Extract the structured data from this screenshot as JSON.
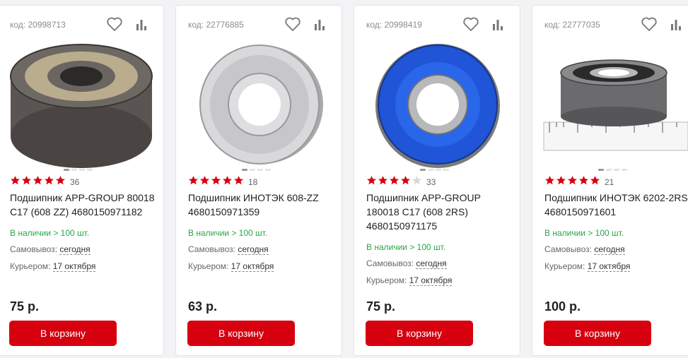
{
  "colors": {
    "accent": "#d6000f",
    "stock": "#28a745",
    "star": "#d6000f"
  },
  "products": [
    {
      "code": "код: 20998713",
      "rating_stars": 5,
      "reviews": "36",
      "title": "Подшипник APP-GROUP 80018 C17 (608 ZZ) 4680150971182",
      "stock": "В наличии > 100 шт.",
      "pickup_label": "Самовывоз:",
      "pickup_value": "сегодня",
      "courier_label": "Курьером:",
      "courier_value": "17 октября",
      "price": "75 р.",
      "button": "В корзину"
    },
    {
      "code": "код: 22776885",
      "rating_stars": 5,
      "reviews": "18",
      "title": "Подшипник ИНОТЭК 608-ZZ 4680150971359",
      "stock": "В наличии > 100 шт.",
      "pickup_label": "Самовывоз:",
      "pickup_value": "сегодня",
      "courier_label": "Курьером:",
      "courier_value": "17 октября",
      "price": "63 р.",
      "button": "В корзину"
    },
    {
      "code": "код: 20998419",
      "rating_stars": 4,
      "reviews": "33",
      "title": "Подшипник APP-GROUP 180018 C17 (608 2RS) 4680150971175",
      "stock": "В наличии > 100 шт.",
      "pickup_label": "Самовывоз:",
      "pickup_value": "сегодня",
      "courier_label": "Курьером:",
      "courier_value": "17 октября",
      "price": "75 р.",
      "button": "В корзину"
    },
    {
      "code": "код: 22777035",
      "rating_stars": 5,
      "reviews": "21",
      "title": "Подшипник ИНОТЭК 6202-2RS 4680150971601",
      "stock": "В наличии > 100 шт.",
      "pickup_label": "Самовывоз:",
      "pickup_value": "сегодня",
      "courier_label": "Курьером:",
      "courier_value": "17 октября",
      "price": "100 р.",
      "button": "В корзину"
    }
  ]
}
